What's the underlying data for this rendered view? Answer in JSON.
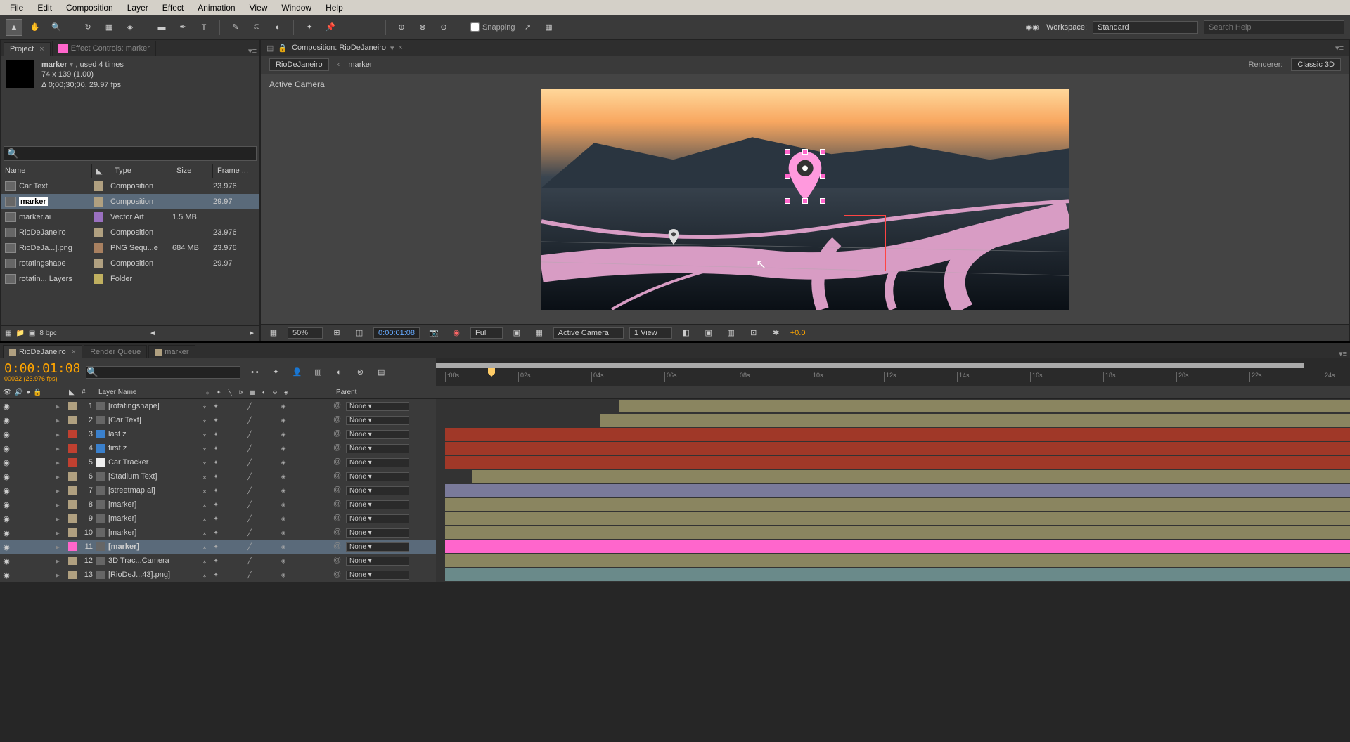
{
  "menubar": [
    "File",
    "Edit",
    "Composition",
    "Layer",
    "Effect",
    "Animation",
    "View",
    "Window",
    "Help"
  ],
  "snapping_label": "Snapping",
  "workspace": {
    "label": "Workspace:",
    "value": "Standard"
  },
  "search_help_placeholder": "Search Help",
  "project": {
    "tab_project": "Project",
    "tab_effect_controls": "Effect Controls: marker",
    "info_name": "marker",
    "info_used": ", used 4 times",
    "info_dims": "74 x 139 (1.00)",
    "info_duration": "Δ 0;00;30;00, 29.97 fps",
    "columns": {
      "name": "Name",
      "type": "Type",
      "size": "Size",
      "frame": "Frame ..."
    },
    "items": [
      {
        "name": "Car Text",
        "label": "#b0a080",
        "type": "Composition",
        "size": "",
        "frame": "23.976"
      },
      {
        "name": "marker",
        "label": "#b0a080",
        "type": "Composition",
        "size": "",
        "frame": "29.97",
        "selected": true
      },
      {
        "name": "marker.ai",
        "label": "#9a70c0",
        "type": "Vector Art",
        "size": "1.5 MB",
        "frame": ""
      },
      {
        "name": "RioDeJaneiro",
        "label": "#b0a080",
        "type": "Composition",
        "size": "",
        "frame": "23.976"
      },
      {
        "name": "RioDeJa...].png",
        "label": "#a88060",
        "type": "PNG Sequ...e",
        "size": "684 MB",
        "frame": "23.976"
      },
      {
        "name": "rotatingshape",
        "label": "#b0a080",
        "type": "Composition",
        "size": "",
        "frame": "29.97"
      },
      {
        "name": "rotatin... Layers",
        "label": "#c0b060",
        "type": "Folder",
        "size": "",
        "frame": ""
      }
    ],
    "bpc": "8 bpc"
  },
  "comp": {
    "title": "Composition: RioDeJaneiro",
    "breadcrumb": [
      "RioDeJaneiro",
      "marker"
    ],
    "renderer_label": "Renderer:",
    "renderer_value": "Classic 3D",
    "viewer_label": "Active Camera",
    "footer": {
      "zoom": "50%",
      "timecode": "0:00:01:08",
      "resolution": "Full",
      "view_menu": "Active Camera",
      "views": "1 View",
      "exposure": "+0.0"
    }
  },
  "timeline": {
    "tabs": [
      "RioDeJaneiro",
      "Render Queue",
      "marker"
    ],
    "timecode": "0:00:01:08",
    "frame_info": "00032 (23.976 fps)",
    "col_layer_name": "Layer Name",
    "col_parent": "Parent",
    "ruler_marks": [
      ":00s",
      "02s",
      "04s",
      "06s",
      "08s",
      "10s",
      "12s",
      "14s",
      "16s",
      "18s",
      "20s",
      "22s",
      "24s"
    ],
    "parent_none": "None",
    "layers": [
      {
        "num": 1,
        "name": "[rotatingshape]",
        "label": "#b0a080",
        "bar_color": "#8a8560",
        "bar_start": 20,
        "selected": false
      },
      {
        "num": 2,
        "name": "[Car Text]",
        "label": "#b0a080",
        "bar_color": "#8a8560",
        "bar_start": 18,
        "selected": false
      },
      {
        "num": 3,
        "name": "last z",
        "label": "#c04030",
        "bar_color": "#a03828",
        "bar_start": 1,
        "selected": false,
        "icon_color": "#3a80cc"
      },
      {
        "num": 4,
        "name": "first z",
        "label": "#c04030",
        "bar_color": "#a03828",
        "bar_start": 1,
        "selected": false,
        "icon_color": "#3a80cc"
      },
      {
        "num": 5,
        "name": "Car Tracker",
        "label": "#c04030",
        "bar_color": "#a03828",
        "bar_start": 1,
        "selected": false,
        "icon_color": "#eeeeee"
      },
      {
        "num": 6,
        "name": "[Stadium Text]",
        "label": "#b0a080",
        "bar_color": "#8a8560",
        "bar_start": 4,
        "selected": false
      },
      {
        "num": 7,
        "name": "[streetmap.ai]",
        "label": "#b0a080",
        "bar_color": "#7a7a9a",
        "bar_start": 1,
        "selected": false
      },
      {
        "num": 8,
        "name": "[marker]",
        "label": "#b0a080",
        "bar_color": "#8a8560",
        "bar_start": 1,
        "selected": false
      },
      {
        "num": 9,
        "name": "[marker]",
        "label": "#b0a080",
        "bar_color": "#8a8560",
        "bar_start": 1,
        "selected": false
      },
      {
        "num": 10,
        "name": "[marker]",
        "label": "#b0a080",
        "bar_color": "#8a8560",
        "bar_start": 1,
        "selected": false
      },
      {
        "num": 11,
        "name": "[marker]",
        "label": "#ff66cc",
        "bar_color": "#ff66cc",
        "bar_start": 1,
        "selected": true
      },
      {
        "num": 12,
        "name": "3D Trac...Camera",
        "label": "#b0a080",
        "bar_color": "#8a8560",
        "bar_start": 1,
        "selected": false
      },
      {
        "num": 13,
        "name": "[RioDeJ...43].png]",
        "label": "#b0a080",
        "bar_color": "#6a8a8a",
        "bar_start": 1,
        "selected": false
      }
    ]
  }
}
